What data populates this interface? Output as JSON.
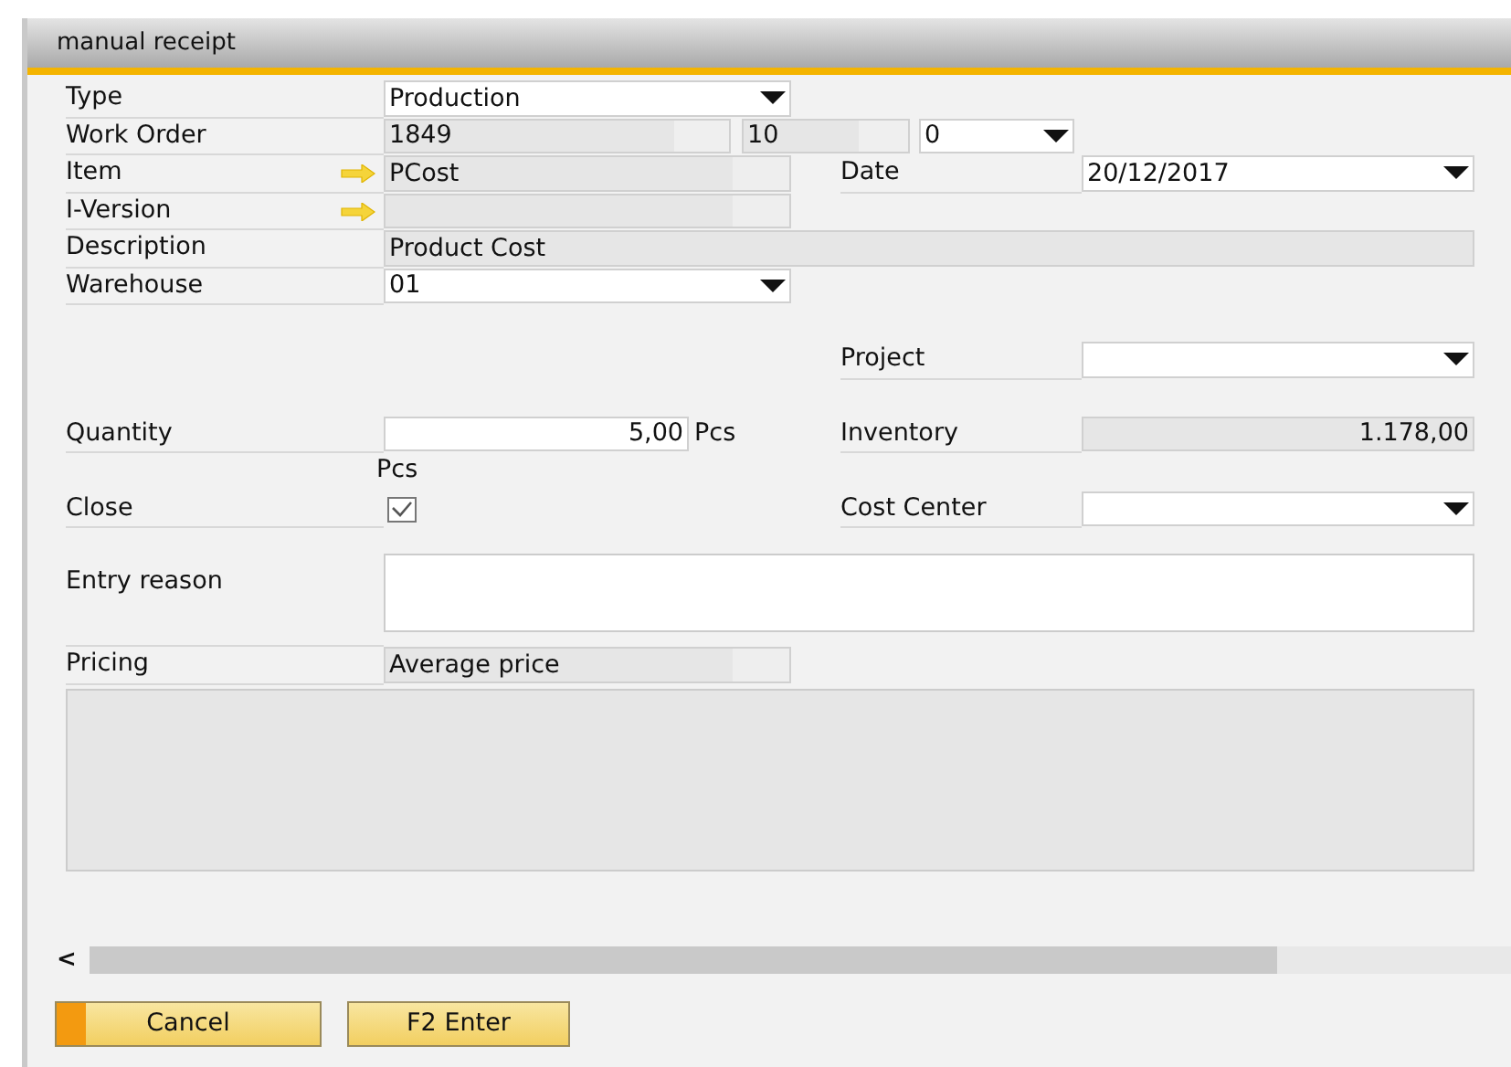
{
  "window": {
    "title": "manual receipt"
  },
  "sections": [
    [
      {
        "left": {
          "label": "Type",
          "kind": "dropdown",
          "value": "Production"
        }
      },
      {
        "left": {
          "label": "Work Order",
          "kind": "work_order",
          "values": [
            "1849",
            "10",
            "0"
          ]
        }
      },
      {
        "left": {
          "label": "Item",
          "kind": "link",
          "value": "PCost"
        },
        "right": {
          "label": "Date",
          "kind": "dropdown",
          "value": "20/12/2017"
        }
      },
      {
        "left": {
          "label": "I-Version",
          "kind": "link"
        }
      },
      {
        "left": {
          "label": "Description",
          "kind": "wide",
          "value": "Product Cost"
        }
      },
      {
        "left": {
          "label": "Warehouse",
          "kind": "dropdown",
          "value": "01"
        }
      }
    ],
    [
      {
        "right": {
          "label": "Project",
          "kind": "dropdown"
        }
      }
    ],
    [
      {
        "left": {
          "label": "Quantity",
          "kind": "number",
          "value": "5,00",
          "unit": "Pcs"
        },
        "right": {
          "label": "Inventory",
          "kind": "amount",
          "value": "1.178,00"
        }
      },
      {
        "left": {
          "kind": "unit",
          "unit": "Pcs"
        }
      },
      {
        "left": {
          "label": "Close",
          "kind": "checkbox",
          "checked": true
        },
        "right": {
          "label": "Cost Center",
          "kind": "dropdown"
        }
      }
    ],
    [
      {
        "left": {
          "label": "Entry reason",
          "kind": "textarea"
        }
      },
      {
        "left": {
          "label": "Pricing",
          "kind": "readonly",
          "value": "Average price"
        }
      }
    ]
  ],
  "scrollbar": {
    "arrow": "<"
  },
  "buttons": [
    {
      "label": "Cancel",
      "focused": true
    },
    {
      "label": "F2 Enter",
      "focused": false
    }
  ]
}
